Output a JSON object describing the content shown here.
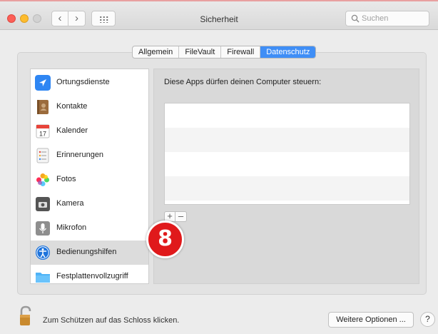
{
  "window": {
    "title": "Sicherheit"
  },
  "toolbar": {
    "back_label": "‹",
    "forward_label": "›",
    "search_placeholder": "Suchen"
  },
  "tabs": [
    {
      "label": "Allgemein",
      "active": false
    },
    {
      "label": "FileVault",
      "active": false
    },
    {
      "label": "Firewall",
      "active": false
    },
    {
      "label": "Datenschutz",
      "active": true
    }
  ],
  "sidebar": {
    "items": [
      {
        "label": "Ortungsdienste",
        "icon": "location-arrow-icon",
        "color": "#2f86f3"
      },
      {
        "label": "Kontakte",
        "icon": "contacts-book-icon",
        "color": "#9b6b3c"
      },
      {
        "label": "Kalender",
        "icon": "calendar-icon",
        "color": "#e8443a",
        "day": "17"
      },
      {
        "label": "Erinnerungen",
        "icon": "reminders-list-icon",
        "color": "#f0f0f0"
      },
      {
        "label": "Fotos",
        "icon": "photos-flower-icon",
        "color": "#f5a623"
      },
      {
        "label": "Kamera",
        "icon": "camera-icon",
        "color": "#555555"
      },
      {
        "label": "Mikrofon",
        "icon": "microphone-icon",
        "color": "#8e8e8e"
      },
      {
        "label": "Bedienungshilfen",
        "icon": "accessibility-icon",
        "color": "#1d73dc",
        "selected": true
      },
      {
        "label": "Festplattenvollzugriff",
        "icon": "folder-icon",
        "color": "#4fb3f6"
      }
    ]
  },
  "main": {
    "heading": "Diese Apps dürfen deinen Computer steuern:",
    "add_label": "+",
    "remove_label": "–"
  },
  "annotation": {
    "step": "8",
    "color": "#e0191b"
  },
  "footer": {
    "lock_text": "Zum Schützen auf das Schloss klicken.",
    "more_options_label": "Weitere Optionen ...",
    "help_label": "?"
  },
  "colors": {
    "accent": "#3f8ef6",
    "window_bg": "#ececec"
  }
}
